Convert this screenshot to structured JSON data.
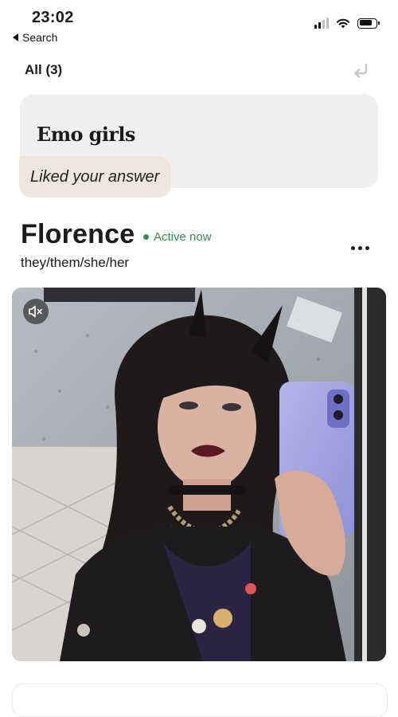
{
  "status_bar": {
    "time": "23:02",
    "back_label": "Search",
    "icons": [
      "cellular-signal-icon",
      "wifi-icon",
      "battery-icon"
    ]
  },
  "header": {
    "filter_label": "All (3)",
    "undo_icon": "undo-arrow-icon"
  },
  "prompt_card": {
    "prompt": "Emo girls",
    "like_label": "Liked your answer"
  },
  "profile": {
    "name": "Florence",
    "status": "Active now",
    "pronouns": "they/them/she/her",
    "more_icon": "more-horizontal-icon",
    "photo": {
      "mute_icon": "speaker-muted-icon",
      "description_icon": "profile-photo"
    }
  },
  "colors": {
    "active_green": "#3b8a5a",
    "prompt_bg": "#f0f0f0",
    "like_bubble_bg": "#eee5dc"
  }
}
